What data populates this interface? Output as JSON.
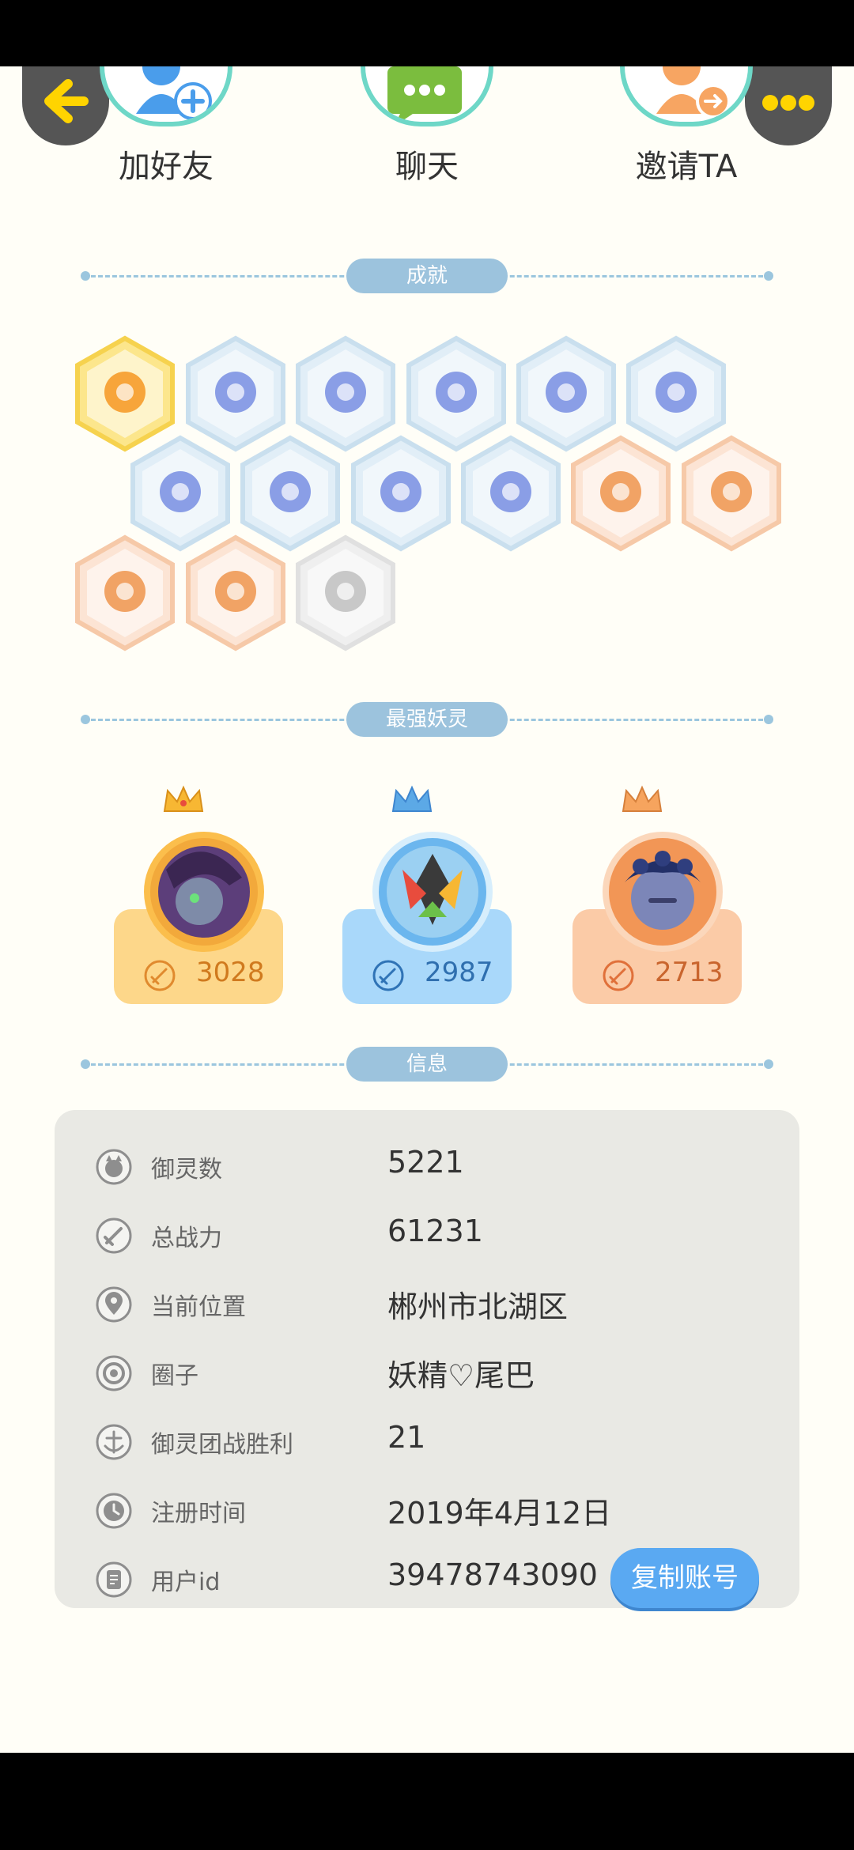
{
  "actions": {
    "add_friend": "加好友",
    "chat": "聊天",
    "invite": "邀请TA"
  },
  "sections": {
    "achievements": "成就",
    "strongest": "最强妖灵",
    "info": "信息"
  },
  "strongest_beasts": [
    {
      "power": "3028",
      "theme": "gold"
    },
    {
      "power": "2987",
      "theme": "blue"
    },
    {
      "power": "2713",
      "theme": "orange"
    }
  ],
  "info": {
    "beast_count": {
      "label": "御灵数",
      "value": "5221"
    },
    "total_power": {
      "label": "总战力",
      "value": "61231"
    },
    "location": {
      "label": "当前位置",
      "value": "郴州市北湖区"
    },
    "circle": {
      "label": "圈子",
      "value": "妖精♡尾巴"
    },
    "team_wins": {
      "label": "御灵团战胜利",
      "value": "21"
    },
    "register_time": {
      "label": "注册时间",
      "value": "2019年4月12日"
    },
    "user_id": {
      "label": "用户id",
      "value": "39478743090"
    },
    "copy_button": "复制账号"
  },
  "colors": {
    "accent_blue": "#5AA9F2",
    "section_pill": "#9CC3DD",
    "gold": "#FDD78A",
    "blue": "#A9D8FA",
    "orange": "#FBCBA7"
  }
}
